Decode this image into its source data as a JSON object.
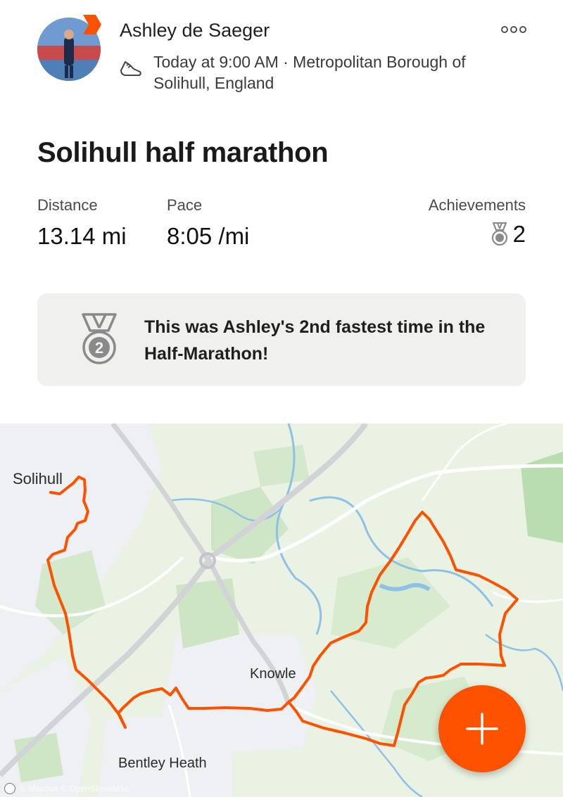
{
  "header": {
    "author": "Ashley de Saeger",
    "meta": "Today at 9:00 AM · Metropolitan Borough of Solihull, England",
    "more_icon": "more-horizontal-icon",
    "activity_icon": "running-shoe-icon"
  },
  "activity": {
    "title": "Solihull half marathon",
    "stats": {
      "distance_label": "Distance",
      "distance_value": "13.14 mi",
      "pace_label": "Pace",
      "pace_value": "8:05 /mi",
      "achievements_label": "Achievements",
      "achievements_value": "2"
    }
  },
  "banner": {
    "text": "This was Ashley's 2nd fastest time in the Half-Marathon!",
    "medal_number": "2"
  },
  "map": {
    "labels": {
      "solihull": "Solihull",
      "knowle": "Knowle",
      "bentley_heath": "Bentley Heath"
    },
    "attribution": "© Mapbox © OpenStreetMap",
    "route_color": "#fc5200"
  },
  "fab": {
    "icon": "plus-icon"
  },
  "colors": {
    "accent": "#fc5200",
    "banner_bg": "#f0f0ee",
    "medal": "#8a8a8a"
  }
}
